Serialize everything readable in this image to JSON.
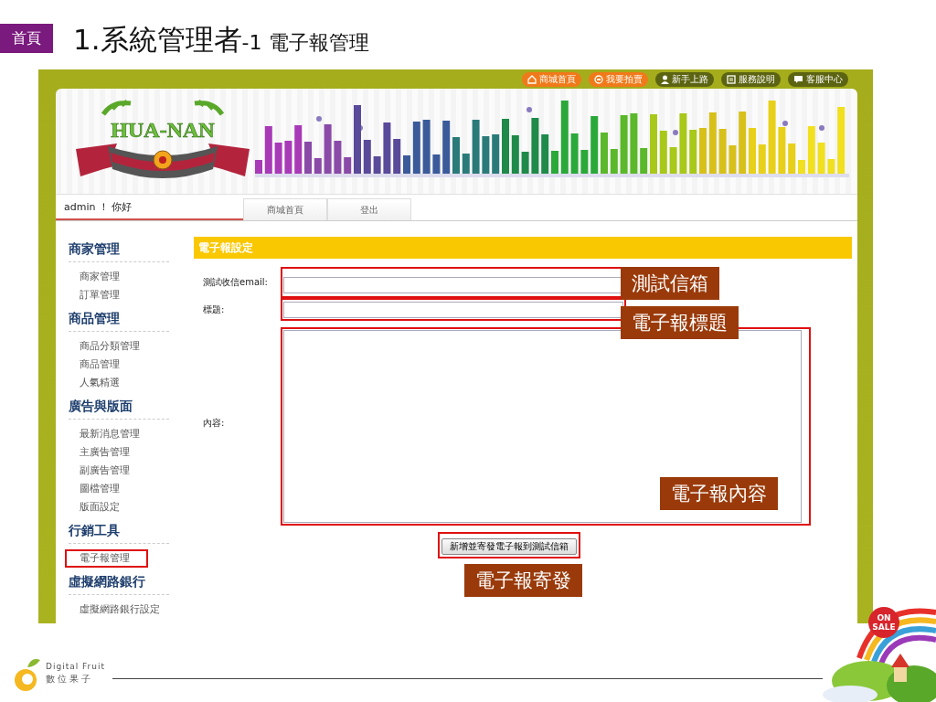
{
  "slide": {
    "home_badge": "首頁",
    "title": "1.系統管理者",
    "subtitle": "-1 電子報管理"
  },
  "site": {
    "top_links": [
      {
        "label": "商城首頁",
        "kind": "promo"
      },
      {
        "label": "我要拍賣",
        "kind": "promo"
      },
      {
        "label": "新手上路",
        "kind": "info"
      },
      {
        "label": "服務說明",
        "kind": "info"
      },
      {
        "label": "客服中心",
        "kind": "info"
      }
    ],
    "logo_text": "HUA-NAN",
    "greeting": "admin ！ 你好",
    "nav_tabs": [
      {
        "label": "商城首頁"
      },
      {
        "label": "登出"
      }
    ]
  },
  "sidebar": [
    {
      "heading": "商家管理",
      "items": [
        {
          "label": "商家管理",
          "annotated": false
        },
        {
          "label": "訂單管理",
          "annotated": false
        }
      ]
    },
    {
      "heading": "商品管理",
      "items": [
        {
          "label": "商品分類管理",
          "annotated": false
        },
        {
          "label": "商品管理",
          "annotated": false
        },
        {
          "label": "人氣精選",
          "annotated": false
        }
      ]
    },
    {
      "heading": "廣告與版面",
      "items": [
        {
          "label": "最新消息管理",
          "annotated": false
        },
        {
          "label": "主廣告管理",
          "annotated": false
        },
        {
          "label": "副廣告管理",
          "annotated": false
        },
        {
          "label": "圖檔管理",
          "annotated": false
        },
        {
          "label": "版面設定",
          "annotated": false
        }
      ]
    },
    {
      "heading": "行銷工具",
      "items": [
        {
          "label": "電子報管理",
          "annotated": true
        }
      ]
    },
    {
      "heading": "虛擬網路銀行",
      "items": [
        {
          "label": "虛擬網路銀行設定",
          "annotated": false
        }
      ]
    }
  ],
  "panel": {
    "title": "電子報設定",
    "fields": [
      {
        "label": "測試收信email:",
        "kind": "input",
        "annotated": true
      },
      {
        "label": "標題:",
        "kind": "input",
        "annotated": true
      },
      {
        "label": "內容:",
        "kind": "textarea",
        "annotated": true
      }
    ],
    "button": {
      "label": "新增並寄發電子報到測試信箱",
      "annotated": true
    }
  },
  "callouts": [
    "測試信箱",
    "電子報標題",
    "電子報內容",
    "電子報寄發"
  ],
  "footer": {
    "brand": "Digital Fruit",
    "brand_sub": "數位果子",
    "sale_badge": "ON SALE"
  }
}
